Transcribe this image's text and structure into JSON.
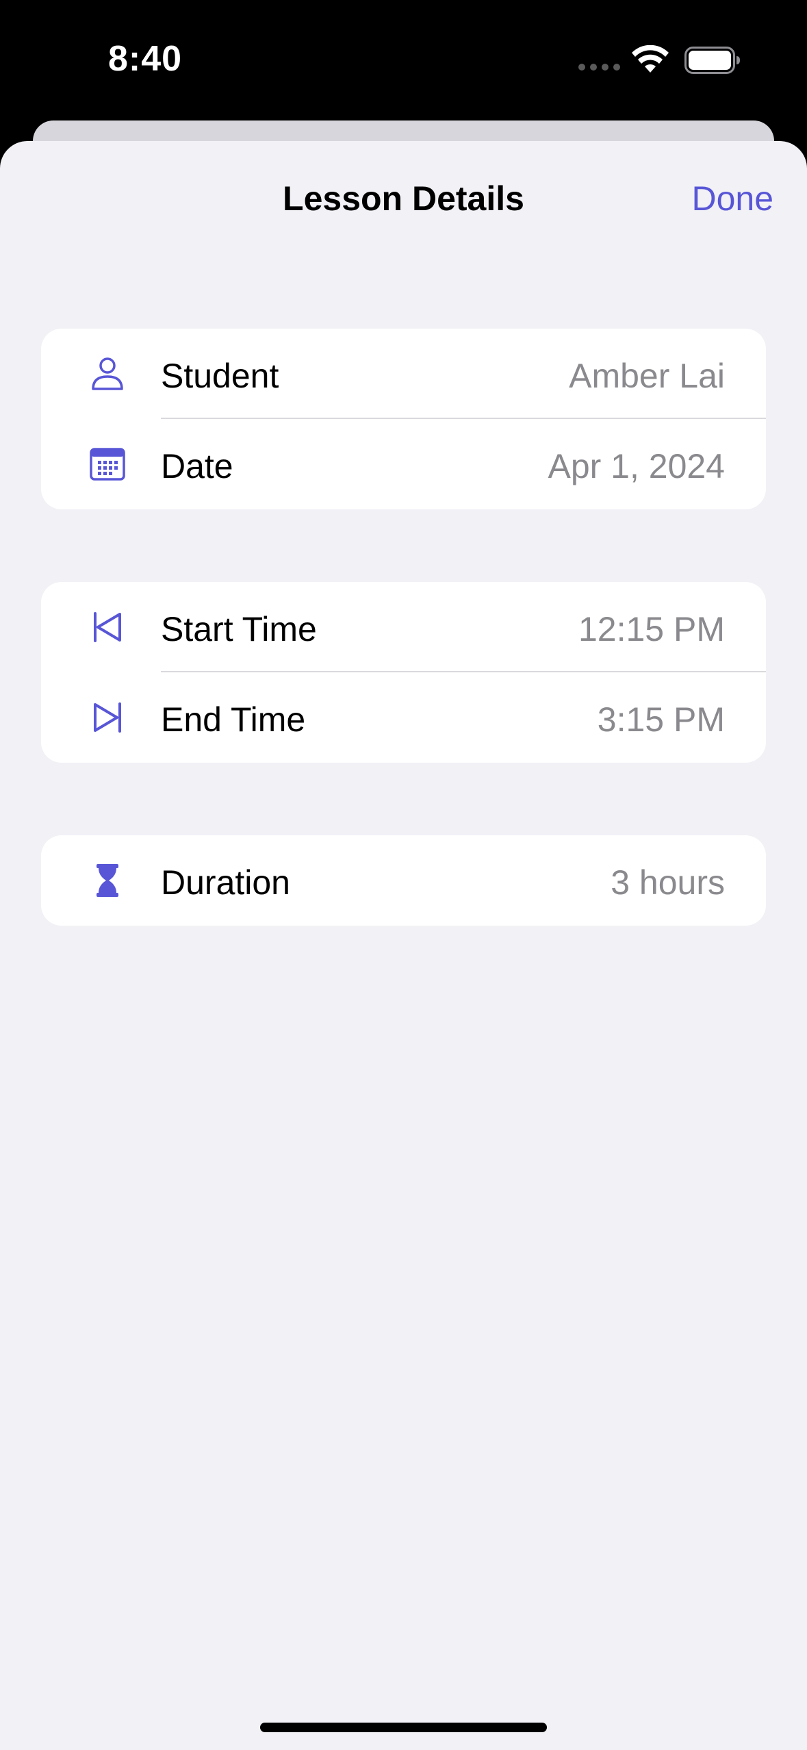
{
  "status_bar": {
    "time": "8:40"
  },
  "nav": {
    "title": "Lesson Details",
    "done_label": "Done"
  },
  "sections": [
    {
      "rows": [
        {
          "icon": "person-icon",
          "label": "Student",
          "value": "Amber Lai"
        },
        {
          "icon": "calendar-icon",
          "label": "Date",
          "value": "Apr 1, 2024"
        }
      ]
    },
    {
      "rows": [
        {
          "icon": "backward-end-icon",
          "label": "Start Time",
          "value": "12:15 PM"
        },
        {
          "icon": "forward-end-icon",
          "label": "End Time",
          "value": "3:15 PM"
        }
      ]
    },
    {
      "rows": [
        {
          "icon": "hourglass-icon",
          "label": "Duration",
          "value": "3 hours"
        }
      ]
    }
  ],
  "colors": {
    "accent": "#5856d6",
    "sheet_background": "#f1f1f6",
    "card_background": "#ffffff",
    "value_text": "#8a8a8e"
  }
}
